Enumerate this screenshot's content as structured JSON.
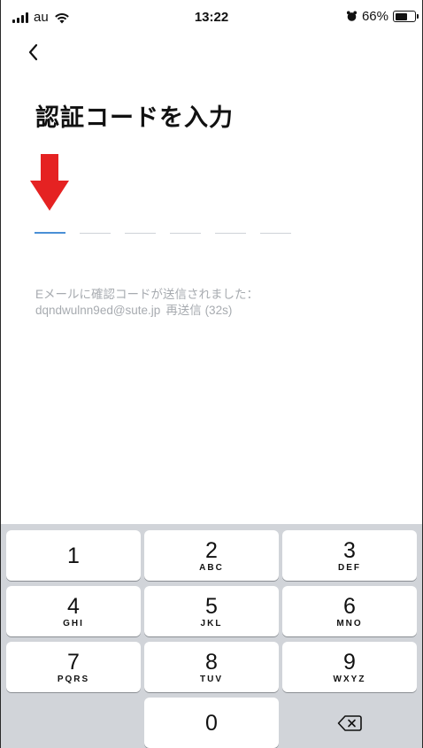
{
  "status_bar": {
    "carrier": "au",
    "time": "13:22",
    "battery_percent": "66%",
    "battery_level": 0.66,
    "icons": [
      "signal-icon",
      "wifi-icon",
      "alarm-icon",
      "battery-icon"
    ]
  },
  "nav": {
    "back_icon": "chevron-left-icon"
  },
  "title": "認証コードを入力",
  "annotation": {
    "icon": "red-down-arrow",
    "color": "#e52222"
  },
  "code_input": {
    "length": 6,
    "active_index": 0,
    "accent": "#4a8fd6"
  },
  "info": {
    "line1": "Eメールに確認コードが送信されました：",
    "email": "dqndwulnn9ed@sute.jp",
    "resend": "再送信 (32s)"
  },
  "keyboard": {
    "keys": [
      {
        "num": "1",
        "letters": ""
      },
      {
        "num": "2",
        "letters": "ABC"
      },
      {
        "num": "3",
        "letters": "DEF"
      },
      {
        "num": "4",
        "letters": "GHI"
      },
      {
        "num": "5",
        "letters": "JKL"
      },
      {
        "num": "6",
        "letters": "MNO"
      },
      {
        "num": "7",
        "letters": "PQRS"
      },
      {
        "num": "8",
        "letters": "TUV"
      },
      {
        "num": "9",
        "letters": "WXYZ"
      },
      {
        "num": "0",
        "letters": ""
      }
    ],
    "delete_icon": "backspace-icon"
  }
}
